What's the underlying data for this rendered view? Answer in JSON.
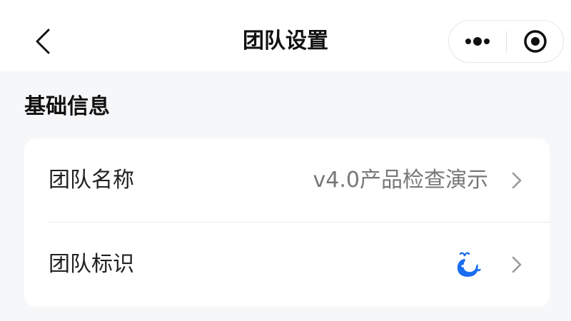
{
  "nav": {
    "title": "团队设置",
    "back_icon": "chevron-left-icon",
    "more_icon": "more-dots-icon",
    "close_icon": "target-circle-icon"
  },
  "section": {
    "title": "基础信息"
  },
  "rows": [
    {
      "label": "团队名称",
      "value": "v4.0产品检查演示",
      "icon": "chevron-right-icon"
    },
    {
      "label": "团队标识",
      "logo_icon": "whale-logo-icon",
      "icon": "chevron-right-icon"
    }
  ],
  "colors": {
    "background": "#f6f7f9",
    "card": "#ffffff",
    "text_primary": "#111111",
    "text_secondary": "#777777",
    "chevron": "#999999",
    "logo_blue": "#1a6cf0"
  }
}
